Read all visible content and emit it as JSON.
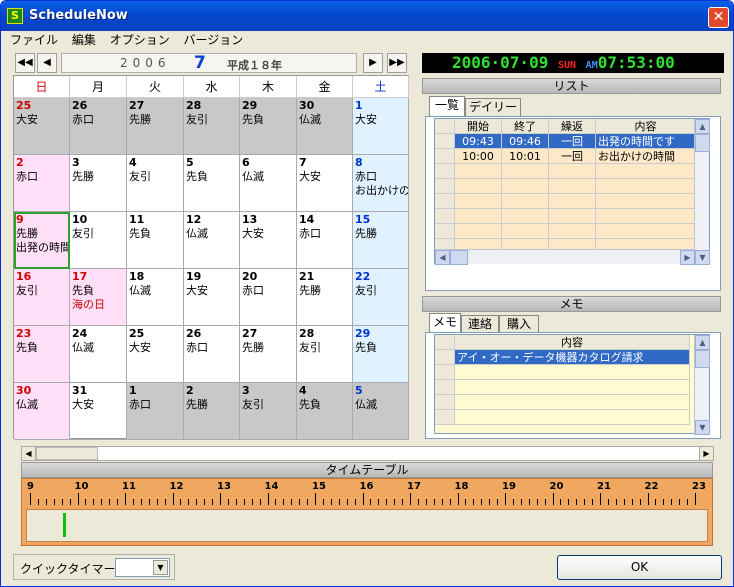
{
  "window": {
    "title": "ScheduleNow",
    "icon_letter": "S"
  },
  "menu": [
    "ファイル",
    "編集",
    "オプション",
    "バージョン"
  ],
  "calendar": {
    "year": "2006",
    "month": "7",
    "era": "平成１８年",
    "weekdays": [
      "日",
      "月",
      "火",
      "水",
      "木",
      "金",
      "土"
    ],
    "weeks": [
      [
        {
          "d": "25",
          "r": "大安",
          "t": "gray-sun"
        },
        {
          "d": "26",
          "r": "赤口",
          "t": "gray"
        },
        {
          "d": "27",
          "r": "先勝",
          "t": "gray"
        },
        {
          "d": "28",
          "r": "友引",
          "t": "gray"
        },
        {
          "d": "29",
          "r": "先負",
          "t": "gray"
        },
        {
          "d": "30",
          "r": "仏滅",
          "t": "gray"
        },
        {
          "d": "1",
          "r": "大安",
          "t": "sat"
        }
      ],
      [
        {
          "d": "2",
          "r": "赤口",
          "t": "sun"
        },
        {
          "d": "3",
          "r": "先勝",
          "t": ""
        },
        {
          "d": "4",
          "r": "友引",
          "t": ""
        },
        {
          "d": "5",
          "r": "先負",
          "t": ""
        },
        {
          "d": "6",
          "r": "仏滅",
          "t": ""
        },
        {
          "d": "7",
          "r": "大安",
          "t": ""
        },
        {
          "d": "8",
          "r": "赤口",
          "e": "お出かけの時",
          "t": "sat"
        }
      ],
      [
        {
          "d": "9",
          "r": "先勝",
          "e": "出発の時間",
          "t": "sun-today"
        },
        {
          "d": "10",
          "r": "友引",
          "t": ""
        },
        {
          "d": "11",
          "r": "先負",
          "t": ""
        },
        {
          "d": "12",
          "r": "仏滅",
          "t": ""
        },
        {
          "d": "13",
          "r": "大安",
          "t": ""
        },
        {
          "d": "14",
          "r": "赤口",
          "t": ""
        },
        {
          "d": "15",
          "r": "先勝",
          "t": "sat"
        }
      ],
      [
        {
          "d": "16",
          "r": "友引",
          "t": "sun"
        },
        {
          "d": "17",
          "r": "先負",
          "h": "海の日",
          "t": "sun"
        },
        {
          "d": "18",
          "r": "仏滅",
          "t": ""
        },
        {
          "d": "19",
          "r": "大安",
          "t": ""
        },
        {
          "d": "20",
          "r": "赤口",
          "t": ""
        },
        {
          "d": "21",
          "r": "先勝",
          "t": ""
        },
        {
          "d": "22",
          "r": "友引",
          "t": "sat"
        }
      ],
      [
        {
          "d": "23",
          "r": "先負",
          "t": "sun"
        },
        {
          "d": "24",
          "r": "仏滅",
          "t": ""
        },
        {
          "d": "25",
          "r": "大安",
          "t": ""
        },
        {
          "d": "26",
          "r": "赤口",
          "t": ""
        },
        {
          "d": "27",
          "r": "先勝",
          "t": ""
        },
        {
          "d": "28",
          "r": "友引",
          "t": ""
        },
        {
          "d": "29",
          "r": "先負",
          "t": "sat"
        }
      ],
      [
        {
          "d": "30",
          "r": "仏滅",
          "t": "sun"
        },
        {
          "d": "31",
          "r": "大安",
          "t": ""
        },
        {
          "d": "1",
          "r": "赤口",
          "t": "gray"
        },
        {
          "d": "2",
          "r": "先勝",
          "t": "gray"
        },
        {
          "d": "3",
          "r": "友引",
          "t": "gray"
        },
        {
          "d": "4",
          "r": "先負",
          "t": "gray"
        },
        {
          "d": "5",
          "r": "仏滅",
          "t": "gray-sat"
        }
      ]
    ]
  },
  "clock": {
    "date": "2006·07·09",
    "dow": "SUN",
    "ampm": "AM",
    "time": "07:53:00"
  },
  "list": {
    "title": "リスト",
    "tabs": [
      "一覧",
      "デイリー"
    ],
    "columns": [
      "開始",
      "終了",
      "繰返",
      "内容"
    ],
    "rows": [
      [
        "09:43",
        "09:46",
        "一回",
        "出発の時間です"
      ],
      [
        "10:00",
        "10:01",
        "一回",
        "お出かけの時間"
      ]
    ]
  },
  "memo": {
    "title": "メモ",
    "tabs": [
      "メモ",
      "連絡",
      "購入"
    ],
    "columns": [
      "内容"
    ],
    "rows": [
      "アイ・オー・データ機器カタログ請求"
    ]
  },
  "timetable": {
    "title": "タイムテーブル",
    "hours": [
      "9",
      "10",
      "11",
      "12",
      "13",
      "14",
      "15",
      "16",
      "17",
      "18",
      "19",
      "20",
      "21",
      "22",
      "23"
    ]
  },
  "quick_timer": {
    "label": "クイックタイマー",
    "value": ""
  },
  "ok_button": "OK"
}
